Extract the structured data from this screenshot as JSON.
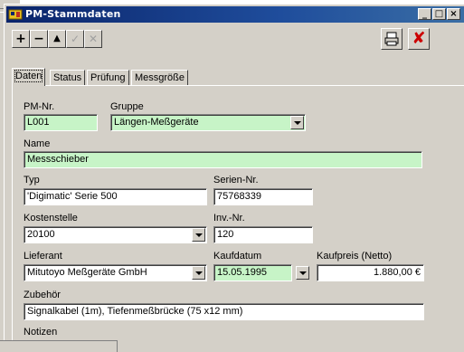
{
  "window": {
    "title": "PM-Stammdaten",
    "minimize": "_",
    "maximize": "□",
    "close": "×"
  },
  "toolbar": {
    "add": "+",
    "remove": "−",
    "up": "▲",
    "check": "✓",
    "cancel": "✕",
    "print": "print",
    "delete": "✘"
  },
  "tabs": [
    {
      "label": "Daten"
    },
    {
      "label": "Status"
    },
    {
      "label": "Prüfung"
    },
    {
      "label": "Messgröße"
    }
  ],
  "form": {
    "pm_nr": {
      "label": "PM-Nr.",
      "value": "L001"
    },
    "gruppe": {
      "label": "Gruppe",
      "value": "Längen-Meßgeräte"
    },
    "name": {
      "label": "Name",
      "value": "Messschieber"
    },
    "typ": {
      "label": "Typ",
      "value": "'Digimatic' Serie 500"
    },
    "serien_nr": {
      "label": "Serien-Nr.",
      "value": "75768339"
    },
    "kostenstelle": {
      "label": "Kostenstelle",
      "value": "20100"
    },
    "inv_nr": {
      "label": "Inv.-Nr.",
      "value": "120"
    },
    "lieferant": {
      "label": "Lieferant",
      "value": "Mitutoyo Meßgeräte GmbH"
    },
    "kaufdatum": {
      "label": "Kaufdatum",
      "value": "15.05.1995"
    },
    "kaufpreis": {
      "label": "Kaufpreis (Netto)",
      "value": "1.880,00 €"
    },
    "zubehoer": {
      "label": "Zubehör",
      "value": "Signalkabel (1m), Tiefenmeßbrücke (75 x12 mm)"
    },
    "notizen": {
      "label": "Notizen"
    }
  },
  "colors": {
    "titlebar": "#0a246a",
    "required_field": "#c7f4c7",
    "delete": "#cc0000"
  }
}
